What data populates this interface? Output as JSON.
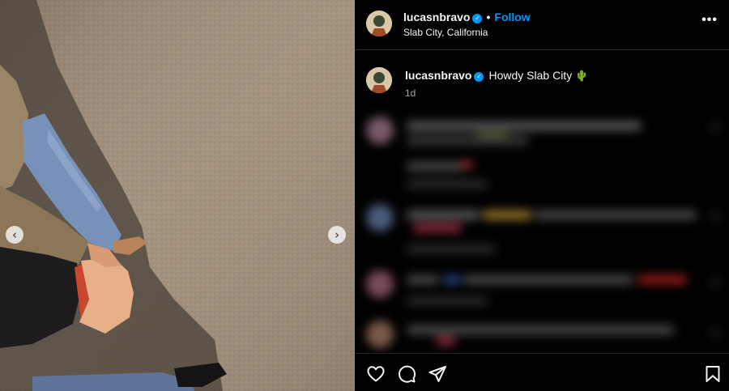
{
  "post": {
    "username": "lucasnbravo",
    "follow_label": "Follow",
    "separator": "•",
    "location": "Slab City, California",
    "more_label": "•••"
  },
  "caption": {
    "username": "lucasnbravo",
    "text": "Howdy Slab City",
    "emoji": "🌵",
    "time": "1d"
  },
  "carousel": {
    "prev_glyph": "‹",
    "next_glyph": "›"
  },
  "icons": {
    "verified": "verified-check-icon",
    "like": "heart-icon",
    "comment": "comment-bubble-icon",
    "share": "paper-plane-icon",
    "save": "bookmark-icon"
  },
  "colors": {
    "background": "#000000",
    "accent": "#0095f6",
    "divider": "#262626",
    "secondary_text": "#a8a8a8"
  }
}
